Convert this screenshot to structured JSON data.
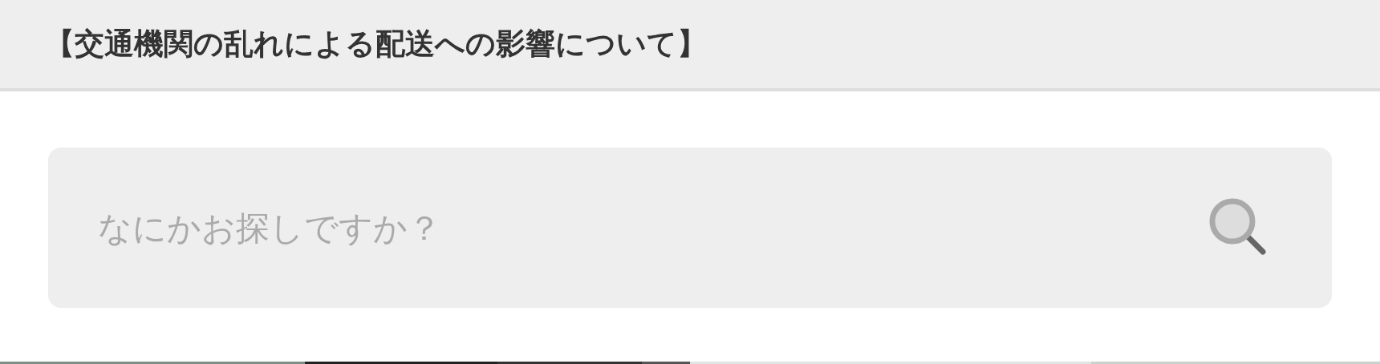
{
  "header": {
    "title": "【交通機関の乱れによる配送への影響について】"
  },
  "search": {
    "placeholder": "なにかお探しですか？"
  }
}
